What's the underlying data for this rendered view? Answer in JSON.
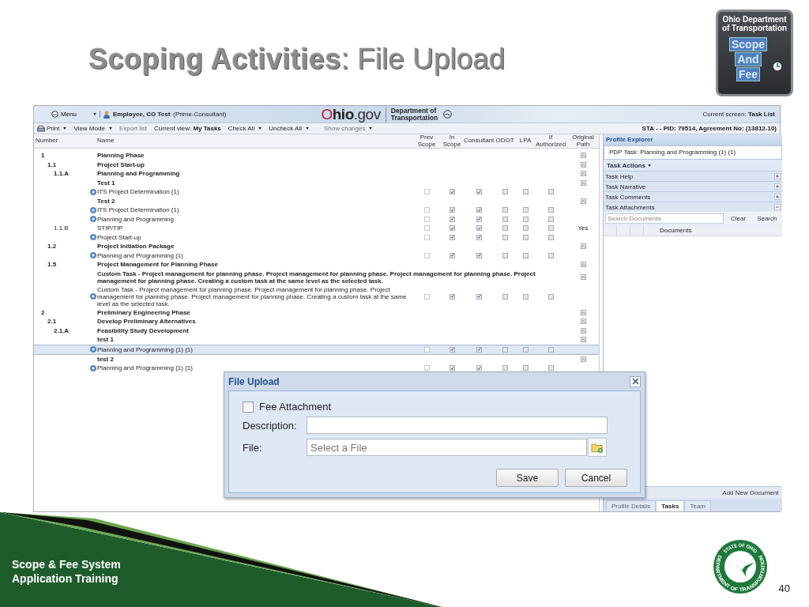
{
  "slide": {
    "title": "**Scoping Activities**: File Upload",
    "logo": {
      "org": "Ohio Department of Transportation",
      "words": [
        "Scope",
        "And",
        "Fee"
      ]
    },
    "footer": [
      "Scope & Fee System",
      "Application Training"
    ],
    "seal": {
      "top": "STATE OF OHIO",
      "bottom": "DEPARTMENT OF TRANSPORTATION"
    },
    "page_number": "40"
  },
  "app": {
    "topbar": {
      "menu": "Menu",
      "user": "Employee, CO Test",
      "role": "(Prime-Consultant)",
      "ohio_logo": "O**hio**.gov",
      "department": "Department of Transportation",
      "current_screen": "Current screen: **Task List**"
    },
    "toolbar": [
      {
        "label": "Print",
        "kind": "print",
        "dropdown": true,
        "disabled": false
      },
      {
        "label": "View Mode",
        "kind": "menu",
        "dropdown": true,
        "disabled": false
      },
      {
        "label": "Export list",
        "kind": "link",
        "dropdown": false,
        "disabled": true
      },
      {
        "label": "Current view: **My Tasks**",
        "kind": "view",
        "dropdown": false,
        "disabled": false
      },
      {
        "label": "Check All",
        "kind": "menu",
        "dropdown": true,
        "disabled": false
      },
      {
        "label": "Uncheck All",
        "kind": "menu",
        "dropdown": true,
        "disabled": false
      },
      {
        "label": "Show changes",
        "kind": "menu",
        "dropdown": true,
        "disabled": true
      }
    ],
    "agreement": "STA - - PID: 79514, Agreement No: (13812-10)",
    "table": {
      "columns": [
        "Number",
        "Name",
        "Prev Scope",
        "In Scope",
        "Consultant",
        "ODOT",
        "LPA",
        "If Authorized",
        "Original Path"
      ],
      "rows": [
        {
          "kind": "group",
          "number": "1",
          "name": "Planning Phase",
          "selected": false
        },
        {
          "kind": "group",
          "number": "1.1",
          "name": "Project Start-up",
          "selected": false
        },
        {
          "kind": "group",
          "number": "1.1.A",
          "name": "Planning and Programming",
          "selected": false
        },
        {
          "kind": "group",
          "name": "Test 1",
          "selected": false
        },
        {
          "kind": "task",
          "name": "ITS Project Determination (1)",
          "checks": [
            false,
            true,
            true,
            false,
            false,
            false
          ],
          "selected": false
        },
        {
          "kind": "group",
          "name": "Test 2",
          "selected": false
        },
        {
          "kind": "task",
          "name": "ITS Project Determination (1)",
          "checks": [
            false,
            true,
            true,
            false,
            false,
            false
          ],
          "selected": false
        },
        {
          "kind": "task",
          "name": "Planning and Programming",
          "checks": [
            false,
            true,
            true,
            false,
            false,
            false
          ],
          "selected": false
        },
        {
          "kind": "item",
          "number": "1.1.B",
          "name": "STIP/TIP",
          "checks": [
            false,
            true,
            true,
            false,
            false,
            false
          ],
          "original_path": "Yes",
          "selected": false
        },
        {
          "kind": "task",
          "name": "Project Start-up",
          "checks": [
            false,
            true,
            true,
            false,
            false,
            false
          ],
          "selected": false
        },
        {
          "kind": "group",
          "number": "1.2",
          "name": "Project Initiation Package",
          "selected": false
        },
        {
          "kind": "task",
          "name": "Planning and Programming (1)",
          "checks": [
            false,
            true,
            true,
            false,
            false,
            false
          ],
          "selected": false
        },
        {
          "kind": "group",
          "number": "1.5",
          "name": "Project Management for Planning Phase",
          "selected": false
        },
        {
          "kind": "group",
          "name": "Custom Task - Project management for planning phase. Project management for planning phase. Project management for planning phase. Project management for planning phase. Creating a custom task at the same level as the selected task.",
          "selected": false
        },
        {
          "kind": "task",
          "name": "Custom Task - Project management for planning phase. Project management for planning phase. Project management for planning phase. Project management for planning phase. Creating a custom task at the same level as the selected task.",
          "checks": [
            false,
            true,
            true,
            false,
            false,
            false
          ],
          "selected": false
        },
        {
          "kind": "group",
          "number": "2",
          "name": "Preliminary Engineering Phase",
          "selected": false
        },
        {
          "kind": "group",
          "number": "2.1",
          "name": "Develop Preliminary Alternatives",
          "selected": false
        },
        {
          "kind": "group",
          "number": "2.1.A",
          "name": "Feasibility Study Development",
          "selected": false
        },
        {
          "kind": "group",
          "name": "test 1",
          "selected": false
        },
        {
          "kind": "task",
          "name": "Planning and Programming (1) (1)",
          "checks": [
            false,
            true,
            true,
            false,
            false,
            false
          ],
          "selected": true
        },
        {
          "kind": "group",
          "name": "test 2",
          "selected": false
        },
        {
          "kind": "task",
          "name": "Planning and Programming (1) (1)",
          "checks": [
            false,
            true,
            true,
            false,
            false,
            false
          ],
          "selected": false
        }
      ]
    },
    "explorer": {
      "title": "Profile Explorer",
      "task": "PDP Task: Planning and Programming (1) (1)",
      "actions": "Task Actions",
      "sections": [
        {
          "label": "Task Help",
          "expanded": false
        },
        {
          "label": "Task Narrative",
          "expanded": false
        },
        {
          "label": "Task Comments",
          "expanded": false
        },
        {
          "label": "Task Attachments",
          "expanded": true
        }
      ],
      "search": {
        "placeholder": "Search Documents"
      },
      "clear": "Clear",
      "search_button": "Search",
      "documents_column": "Documents",
      "add": "Add New Document",
      "tabs": [
        {
          "label": "Profile Details",
          "selected": false
        },
        {
          "label": "Tasks",
          "selected": true
        },
        {
          "label": "Team",
          "selected": false
        }
      ]
    }
  },
  "dialog": {
    "title": "File Upload",
    "fee_attachment": {
      "label": "Fee Attachment",
      "checked": false
    },
    "description_label": "Description:",
    "file_label": "File:",
    "file": {
      "placeholder": "Select a File"
    },
    "buttons": [
      "Save",
      "Cancel"
    ]
  }
}
